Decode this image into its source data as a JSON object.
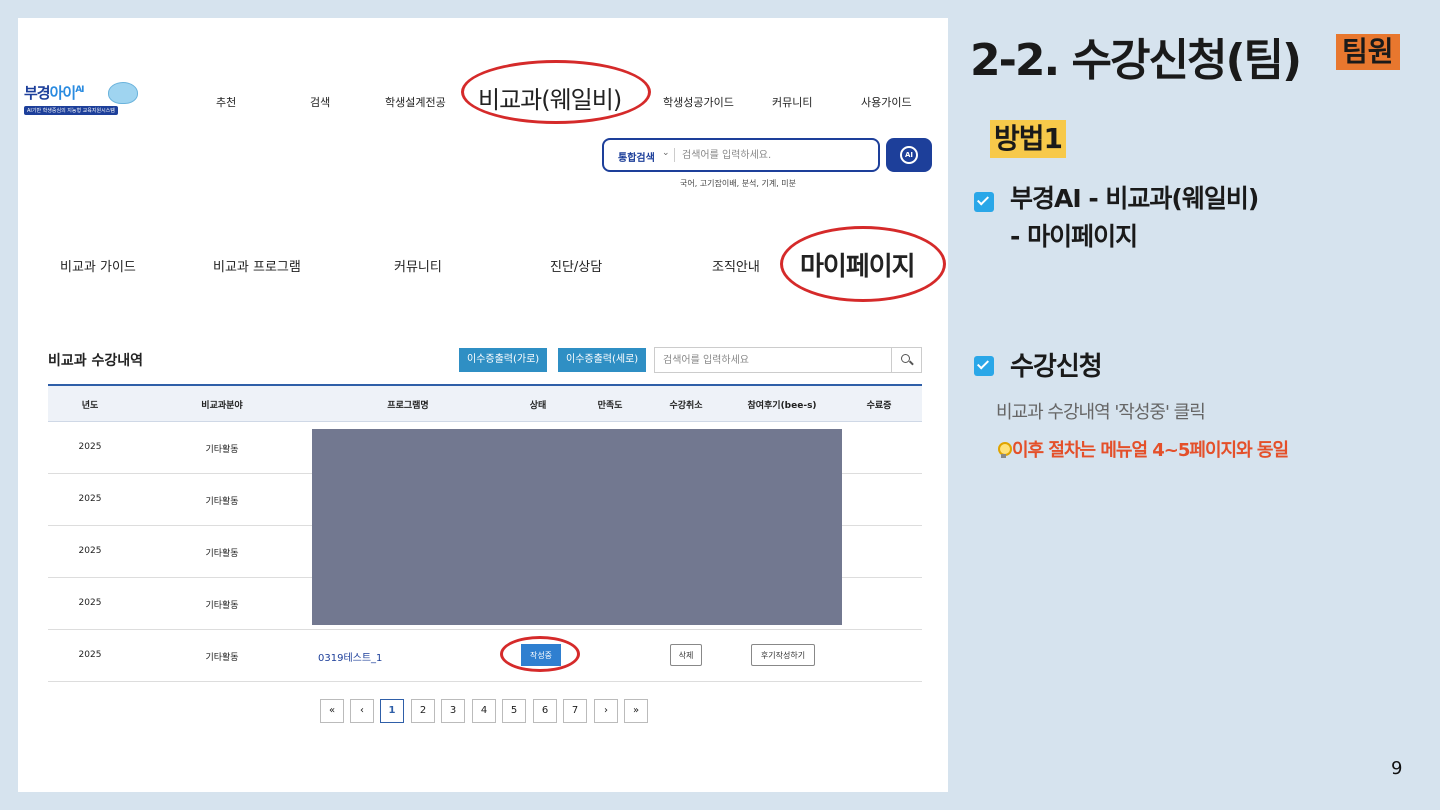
{
  "screenshot": {
    "logo": {
      "main_a": "부경",
      "main_b": "아이",
      "main_ai": "AI",
      "sub": "AI기반 학생중심의 지능형 교육지원시스템"
    },
    "topnav": [
      "추천",
      "검색",
      "학생설계전공",
      "비교과(웨일비)",
      "학생성공가이드",
      "커뮤니티",
      "사용가이드"
    ],
    "search": {
      "category": "통합검색",
      "placeholder": "검색어를 입력하세요.",
      "button_icon": "AI",
      "keywords": "국어,   고기잡이배,   분석,   기계,   미분"
    },
    "subnav": [
      "비교과 가이드",
      "비교과 프로그램",
      "커뮤니티",
      "진단/상담",
      "조직안내",
      "마이페이지"
    ],
    "section_title": "비교과 수강내역",
    "print_buttons": [
      "이수증출력(가로)",
      "이수증출력(세로)"
    ],
    "table_search_placeholder": "검색어를 입력하세요",
    "columns": [
      "년도",
      "비교과분야",
      "프로그램명",
      "상태",
      "만족도",
      "수강취소",
      "참여후기(bee-s)",
      "수료증"
    ],
    "rows": [
      {
        "year": "2025",
        "field": "기타활동"
      },
      {
        "year": "2025",
        "field": "기타활동"
      },
      {
        "year": "2025",
        "field": "기타활동"
      },
      {
        "year": "2025",
        "field": "기타활동"
      },
      {
        "year": "2025",
        "field": "기타활동",
        "program": "0319테스트_1",
        "status": "작성중",
        "cancel": "삭제",
        "review": "후기작성하기"
      }
    ],
    "pager": [
      "«",
      "‹",
      "1",
      "2",
      "3",
      "4",
      "5",
      "6",
      "7",
      "›",
      "»"
    ],
    "active_page": "1"
  },
  "slide": {
    "title": "2-2. 수강신청(팀)",
    "badge": "팀원",
    "method": "방법1",
    "bullet1_line1": "부경AI - 비교과(웨일비)",
    "bullet1_line2": "- 마이페이지",
    "bullet2": "수강신청",
    "note": "비교과 수강내역 '작성중' 클릭",
    "tip": "이후 절차는 메뉴얼 4~5페이지와 동일",
    "page_number": "9"
  },
  "colors": {
    "accent_red": "#d52a2a",
    "navy": "#1d3f9a",
    "badge_orange": "#e8772e",
    "method_yellow": "#f7c94a",
    "tip_orange": "#e4502a",
    "check_blue": "#2aa7e8",
    "redaction": "#727890"
  }
}
